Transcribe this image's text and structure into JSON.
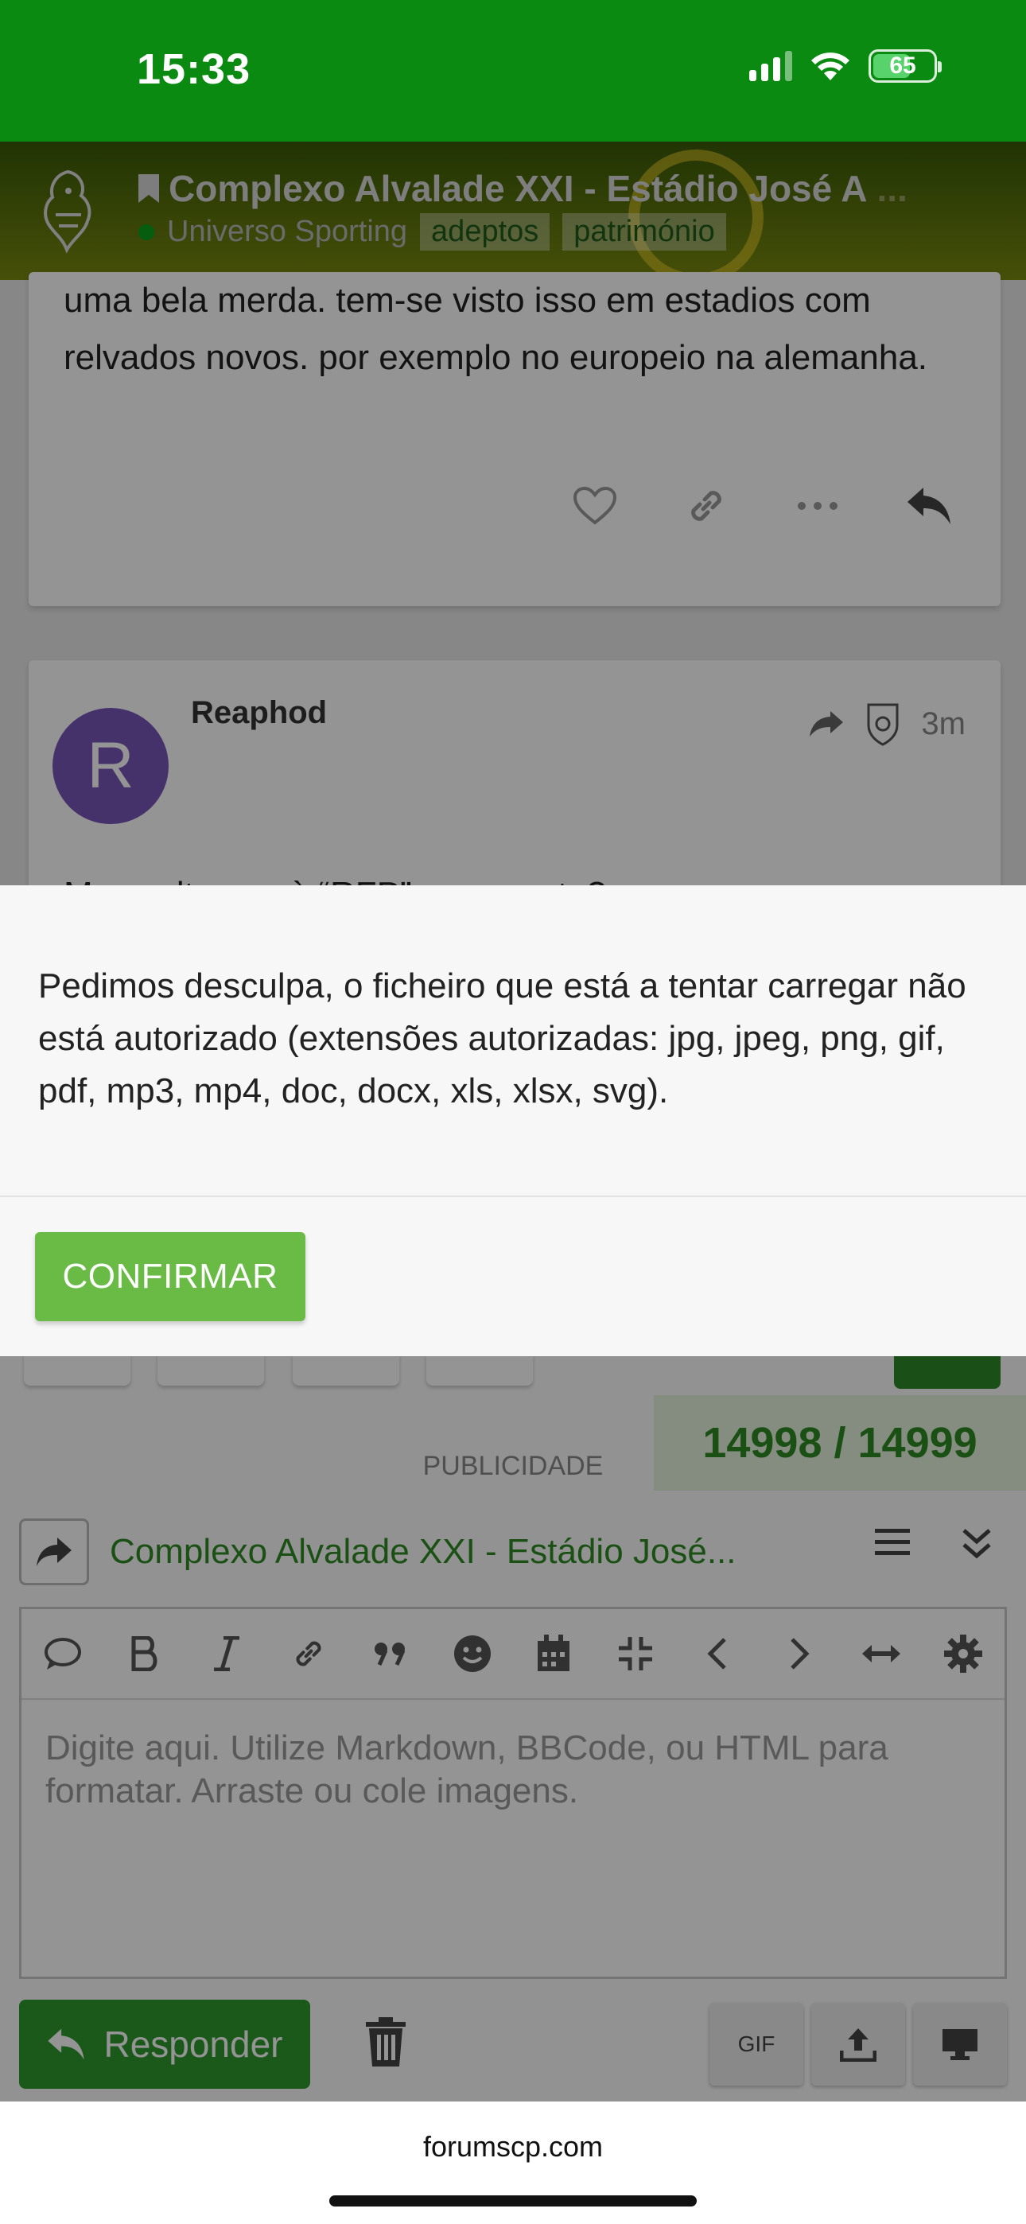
{
  "status_bar": {
    "time": "15:33",
    "battery": "65",
    "battery_level": 0.65
  },
  "topic": {
    "title": "Complexo Alvalade XXI - Estádio José A",
    "title_truncated": "...",
    "category": "Universo Sporting",
    "tags": [
      "adeptos",
      "património"
    ]
  },
  "posts": [
    {
      "body": "uma bela merda. tem-se visto isso em estadios com relvados novos. por exemplo no europeio na alemanha."
    },
    {
      "username": "Reaphod",
      "avatar_letter": "R",
      "time": "3m",
      "body_cut": "Mas voltamos à “RFP” na gravata?"
    }
  ],
  "editor": {
    "counter": "14998 / 14999",
    "ad_label": "PUBLICIDADE",
    "reply_title": "Complexo Alvalade XXI - Estádio José...",
    "placeholder": "Digite aqui. Utilize Markdown, BBCode, ou HTML para formatar. Arraste ou cole imagens.",
    "reply_button": "Responder",
    "gif_label": "GIF"
  },
  "modal": {
    "message": "Pedimos desculpa, o ficheiro que está a tentar carregar não está autorizado (extensões autorizadas: jpg, jpeg, png, gif, pdf, mp3, mp4, doc, docx, xls, xlsx, svg).",
    "confirm_label": "CONFIRMAR"
  },
  "browser": {
    "url": "forumscp.com"
  },
  "colors": {
    "brand_green": "#0b8a12",
    "confirm_green": "#6abb45",
    "counter_text": "#2f8a24"
  }
}
